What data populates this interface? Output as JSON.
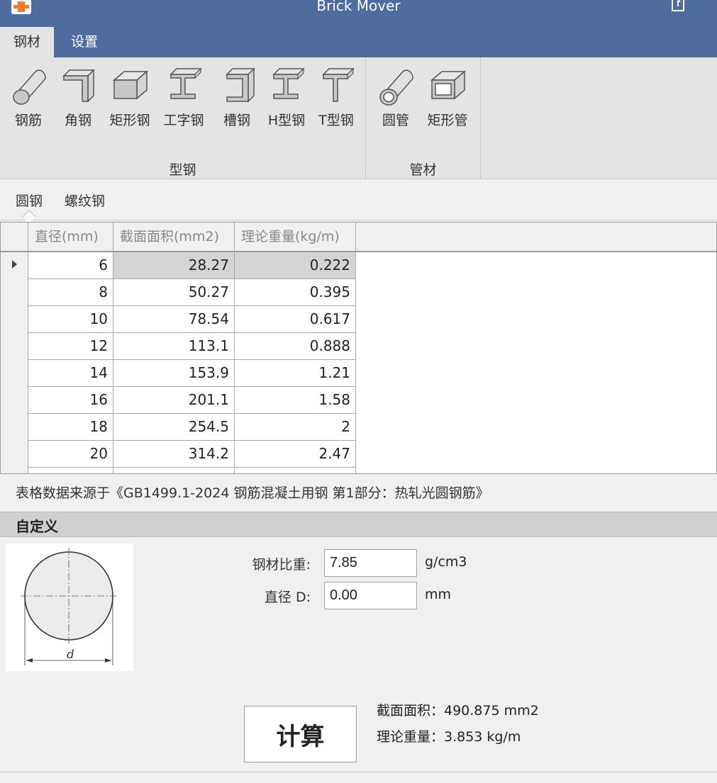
{
  "window": {
    "title": "Brick Mover"
  },
  "menu": {
    "tabs": [
      {
        "label": "钢材",
        "active": true
      },
      {
        "label": "设置",
        "active": false
      }
    ]
  },
  "ribbon": {
    "groups": [
      {
        "label": "型钢",
        "items": [
          {
            "label": "钢筋",
            "icon": "round-bar-icon"
          },
          {
            "label": "角钢",
            "icon": "angle-steel-icon"
          },
          {
            "label": "矩形钢",
            "icon": "rectangular-steel-icon"
          },
          {
            "label": "工字钢",
            "icon": "i-beam-icon"
          },
          {
            "label": "槽钢",
            "icon": "channel-steel-icon"
          },
          {
            "label": "H型钢",
            "icon": "h-beam-icon"
          },
          {
            "label": "T型钢",
            "icon": "t-beam-icon"
          }
        ]
      },
      {
        "label": "管材",
        "items": [
          {
            "label": "圆管",
            "icon": "round-tube-icon"
          },
          {
            "label": "矩形管",
            "icon": "rectangular-tube-icon"
          }
        ]
      }
    ]
  },
  "subtabs": [
    {
      "label": "圆钢",
      "active": true
    },
    {
      "label": "螺纹钢",
      "active": false
    }
  ],
  "table": {
    "columns": [
      "直径(mm)",
      "截面面积(mm2)",
      "理论重量(kg/m)"
    ],
    "rows": [
      [
        "6",
        "28.27",
        "0.222"
      ],
      [
        "8",
        "50.27",
        "0.395"
      ],
      [
        "10",
        "78.54",
        "0.617"
      ],
      [
        "12",
        "113.1",
        "0.888"
      ],
      [
        "14",
        "153.9",
        "1.21"
      ],
      [
        "16",
        "201.1",
        "1.58"
      ],
      [
        "18",
        "254.5",
        "2"
      ],
      [
        "20",
        "314.2",
        "2.47"
      ]
    ],
    "selected_row": 0
  },
  "source_note": "表格数据来源于《GB1499.1-2024 钢筋混凝土用钢 第1部分：热轧光圆钢筋》",
  "custom": {
    "title": "自定义",
    "diagram_label": "d",
    "density": {
      "label": "钢材比重:",
      "value": "7.85",
      "unit": "g/cm3"
    },
    "diameter": {
      "label": "直径 D:",
      "value": "0.00",
      "unit": "mm"
    },
    "calc_label": "计算",
    "result_area": "截面面积：490.875 mm2",
    "result_weight": "理论重量：3.853 kg/m"
  },
  "colors": {
    "titlebar": "#4e6c9d",
    "ribbon": "#e4e4e4",
    "selected_cell": "#d4d4d4",
    "app_icon": "#f07a2c"
  }
}
